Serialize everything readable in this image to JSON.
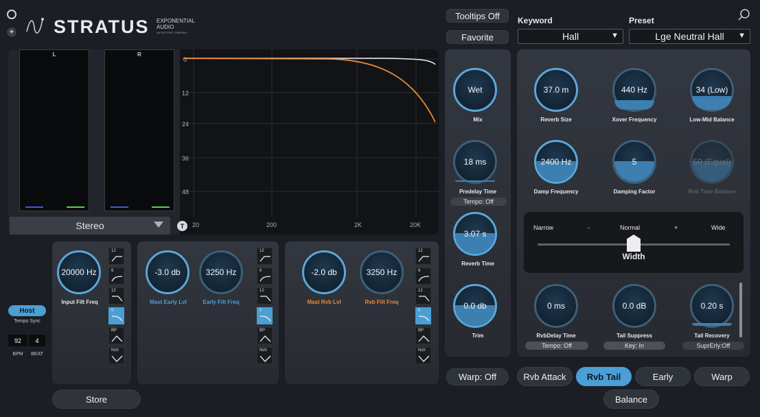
{
  "header": {
    "logo_text": "STRATUS",
    "brand_line1": "EXPONENTIAL",
    "brand_line2": "AUDIO",
    "brand_line3": "AN iZOTOPE COMPANY",
    "tooltips_label": "Tooltips Off",
    "favorite_label": "Favorite"
  },
  "keyword": {
    "label": "Keyword",
    "value": "Hall"
  },
  "preset": {
    "label": "Preset",
    "value": "Lge Neutral Hall"
  },
  "meters": {
    "left_label": "L",
    "right_label": "R",
    "mode": "Stereo"
  },
  "eq_graph": {
    "y_labels": [
      "0",
      "12",
      "24",
      "36",
      "48"
    ],
    "x_labels": [
      "20",
      "200",
      "2K",
      "20K"
    ],
    "t_button": "T"
  },
  "center_column": {
    "mix": {
      "value": "Wet",
      "label": "Mix"
    },
    "predelay": {
      "value": "18 ms",
      "label": "Predelay Time",
      "tempo": "Tempo: Off"
    },
    "reverb_time": {
      "value": "3.07 s",
      "label": "Reverb Time"
    },
    "trim": {
      "value": "0.0 db",
      "label": "Trim"
    },
    "warp_button": "Warp: Off"
  },
  "right_panel": {
    "reverb_size": {
      "value": "37.0 m",
      "label": "Reverb Size"
    },
    "xover": {
      "value": "440 Hz",
      "label": "Xover Frequency"
    },
    "lowmid": {
      "value": "34 (Low)",
      "label": "Low-Mid Balance"
    },
    "damp_freq": {
      "value": "2400 Hz",
      "label": "Damp Frequency"
    },
    "damp_factor": {
      "value": "5",
      "label": "Damping Factor"
    },
    "rvb_time_balance": {
      "value": "50 (Equal)",
      "label": "Rvb Time Balance"
    },
    "width": {
      "narrow": "Narrow",
      "minus": "-",
      "normal": "Normal",
      "plus": "+",
      "wide": "Wide",
      "label": "Width",
      "position": 0.5
    },
    "rvb_delay": {
      "value": "0 ms",
      "label": "RvbDelay Time",
      "pill": "Tempo: Off"
    },
    "tail_suppress": {
      "value": "0.0 dB",
      "label": "Tail Suppress",
      "pill": "Key: In"
    },
    "tail_recovery": {
      "value": "0.20 s",
      "label": "Tail Recovery",
      "pill": "SuprErly:Off"
    }
  },
  "tabs": {
    "rvb_attack": "Rvb Attack",
    "rvb_tail": "Rvb Tail",
    "early": "Early",
    "warp": "Warp",
    "balance": "Balance"
  },
  "filters": {
    "input": {
      "value": "20000 Hz",
      "label": "Input Filt Freq"
    },
    "mast_early": {
      "value": "-3.0 db",
      "label": "Mast Early Lvl"
    },
    "early_filt": {
      "value": "3250 Hz",
      "label": "Early Filt Freq"
    },
    "mast_rvb": {
      "value": "-2.0 db",
      "label": "Mast Rvb Lvl"
    },
    "rvb_filt": {
      "value": "3250 Hz",
      "label": "Rvb Filt Freq"
    },
    "type_labels": [
      "12",
      "6",
      "12",
      "6",
      "BP",
      "Nch"
    ]
  },
  "tempo": {
    "host_button": "Host",
    "tempo_sync": "Tempo Sync",
    "bpm_value": "92",
    "beat_value": "4",
    "bpm_label": "BPM",
    "beat_label": "BEAT"
  },
  "store_button": "Store",
  "colors": {
    "accent": "#4b9fd5",
    "orange": "#e98a36"
  }
}
